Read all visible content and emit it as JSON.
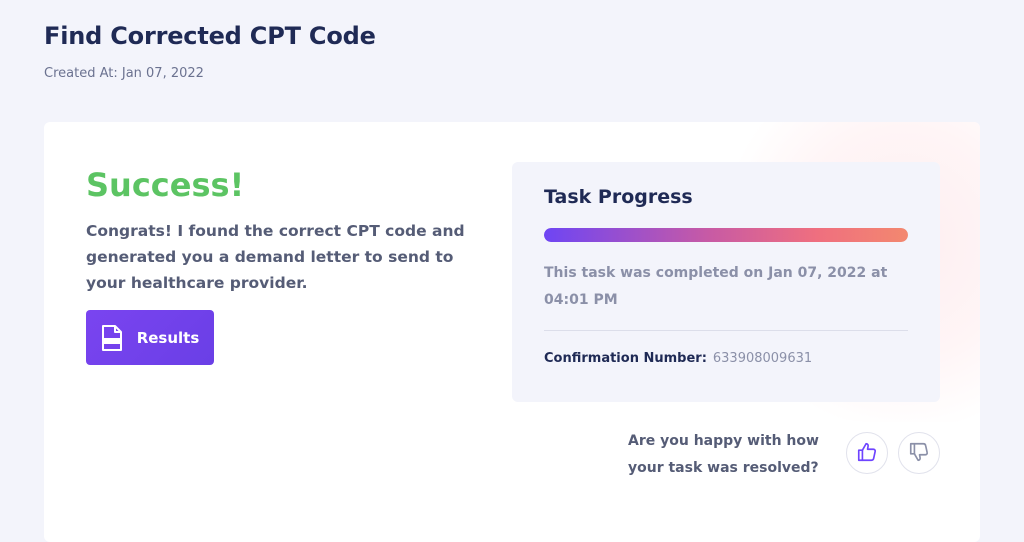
{
  "header": {
    "title": "Find Corrected CPT Code",
    "created_at": "Created At: Jan 07, 2022"
  },
  "result": {
    "title": "Success!",
    "message": "Congrats! I found the correct CPT code and generated you a demand letter to send to your healthcare provider.",
    "results_button_label": "Results",
    "results_icon": "document-icon"
  },
  "progress": {
    "title": "Task Progress",
    "percent": 100,
    "completed_text": "This task was completed on Jan 07, 2022 at 04:01 PM",
    "confirmation_label": "Confirmation Number:",
    "confirmation_number": "633908009631"
  },
  "feedback": {
    "question": "Are you happy with how your task was resolved?",
    "thumbs_up_icon": "thumbs-up-icon",
    "thumbs_down_icon": "thumbs-down-icon"
  },
  "colors": {
    "accent": "#6e44ff",
    "success": "#5cc463",
    "heading": "#1f2a55"
  }
}
